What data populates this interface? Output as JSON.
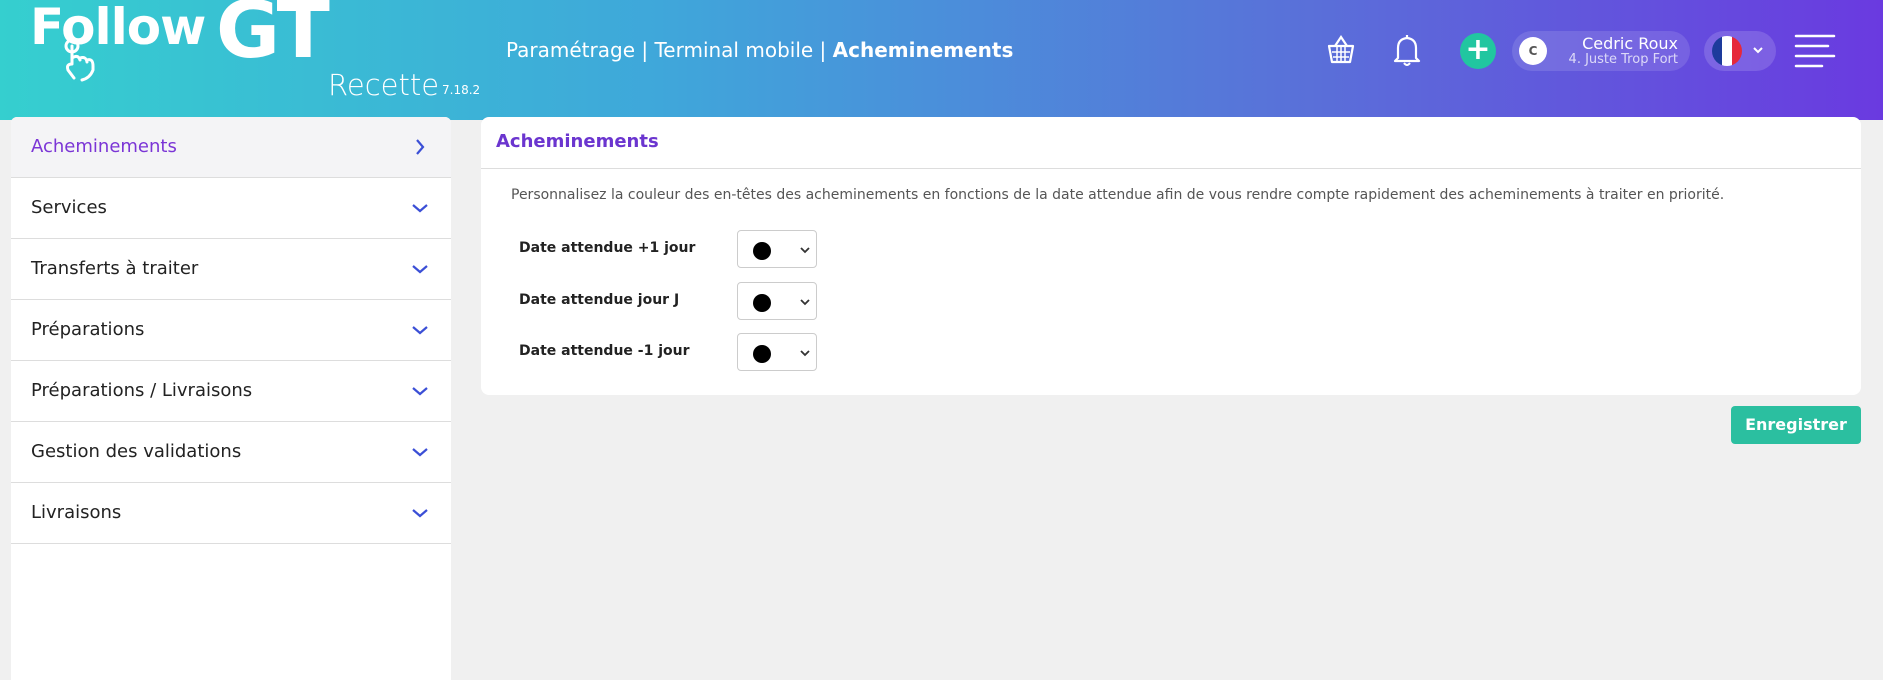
{
  "header": {
    "logo": {
      "word": "Follow",
      "brand": "GT",
      "environment": "Recette",
      "version": "7.18.2"
    },
    "breadcrumb": {
      "part1": "Paramétrage",
      "sep": " | ",
      "part2": "Terminal mobile",
      "current": "Acheminements"
    },
    "icons": [
      "basket-icon",
      "bell-icon",
      "plus-icon",
      "hamburger-menu-icon"
    ],
    "user": {
      "initial": "C",
      "name": "Cedric Roux",
      "role": "4. Juste Trop Fort"
    },
    "language": {
      "flag": "fr",
      "flag_colors": [
        "#1d3b9c",
        "#ffffff",
        "#e6283a"
      ]
    }
  },
  "sidebar": {
    "items": [
      {
        "label": "Acheminements",
        "active": true
      },
      {
        "label": "Services",
        "active": false
      },
      {
        "label": "Transferts à traiter",
        "active": false
      },
      {
        "label": "Préparations",
        "active": false
      },
      {
        "label": "Préparations / Livraisons",
        "active": false
      },
      {
        "label": "Gestion des validations",
        "active": false
      },
      {
        "label": "Livraisons",
        "active": false
      }
    ]
  },
  "main": {
    "title": "Acheminements",
    "description": "Personnalisez la couleur des en-têtes des acheminements en fonctions de la date attendue afin de vous rendre compte rapidement des acheminements à traiter en priorité.",
    "fields": [
      {
        "label": "Date attendue +1 jour",
        "color": "#000000"
      },
      {
        "label": "Date attendue jour J",
        "color": "#000000"
      },
      {
        "label": "Date attendue -1 jour",
        "color": "#000000"
      }
    ],
    "save_label": "Enregistrer"
  },
  "colors": {
    "accent": "#6b35cf",
    "primary_button": "#2bbfa0",
    "add_button": "#21c6a0",
    "chevron": "#3b4fd6"
  }
}
